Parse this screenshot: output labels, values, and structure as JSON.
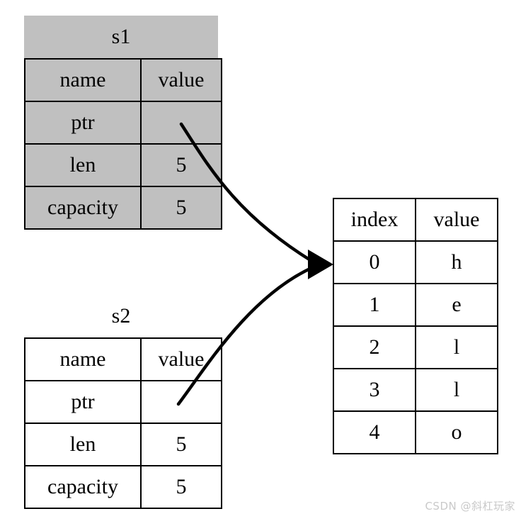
{
  "diagram": {
    "title_s1": "s1",
    "title_s2": "s2",
    "watermark": "CSDN @斜杠玩家",
    "colors": {
      "shaded_fill": "#c0c0c0",
      "plain_fill": "#ffffff",
      "stroke": "#000000",
      "watermark": "#c9c9c9"
    }
  },
  "s1": {
    "label": "s1",
    "shaded": true,
    "header": {
      "name": "name",
      "value": "value"
    },
    "rows": [
      {
        "name": "ptr",
        "value": ""
      },
      {
        "name": "len",
        "value": "5"
      },
      {
        "name": "capacity",
        "value": "5"
      }
    ]
  },
  "s2": {
    "label": "s2",
    "shaded": false,
    "header": {
      "name": "name",
      "value": "value"
    },
    "rows": [
      {
        "name": "ptr",
        "value": ""
      },
      {
        "name": "len",
        "value": "5"
      },
      {
        "name": "capacity",
        "value": "5"
      }
    ]
  },
  "heap": {
    "header": {
      "index": "index",
      "value": "value"
    },
    "rows": [
      {
        "index": "0",
        "value": "h"
      },
      {
        "index": "1",
        "value": "e"
      },
      {
        "index": "2",
        "value": "l"
      },
      {
        "index": "3",
        "value": "l"
      },
      {
        "index": "4",
        "value": "o"
      }
    ]
  },
  "arrows": [
    {
      "name": "s1-ptr-to-heap",
      "from": "s1.ptr",
      "to": "heap.row0"
    },
    {
      "name": "s2-ptr-to-heap",
      "from": "s2.ptr",
      "to": "heap.row0"
    }
  ]
}
